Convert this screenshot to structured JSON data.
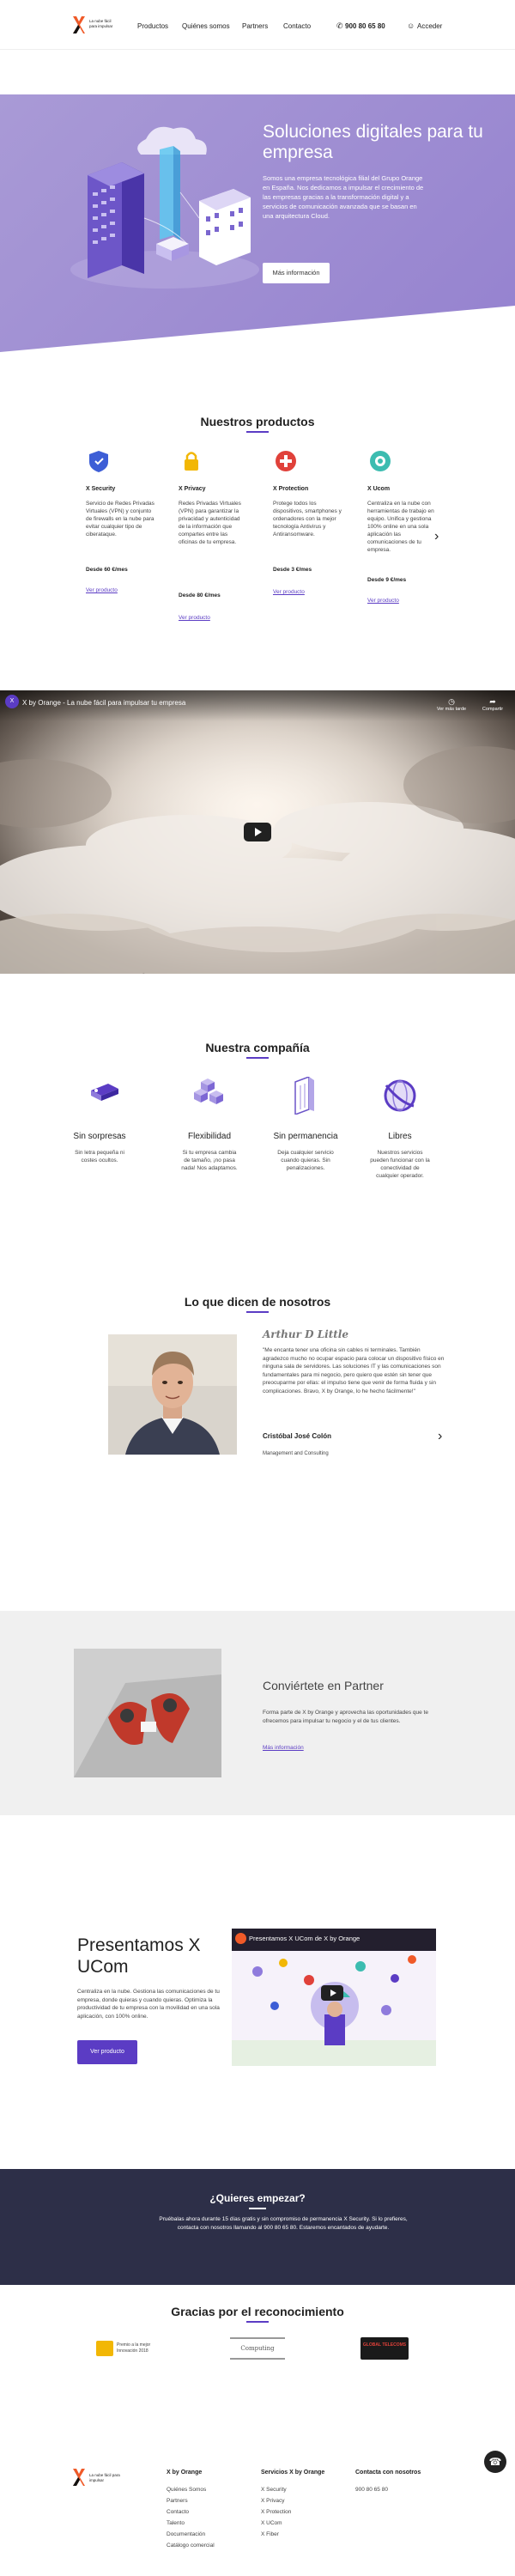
{
  "colors": {
    "accent": "#5b3cc4",
    "hero_bg": "#9d8cd2",
    "orange": "#f05a28",
    "dark_band": "#2d2f48"
  },
  "header": {
    "logo_text": "La nube fácil",
    "logo_subtext": "para impulsar",
    "nav": [
      "Productos",
      "Quiénes somos",
      "Partners",
      "Contacto"
    ],
    "phone": "900 80 65 80",
    "account": "Acceder"
  },
  "hero": {
    "title": "Soluciones digitales para tu empresa",
    "text": "Somos una empresa tecnológica filial del Grupo Orange en España. Nos dedicamos a impulsar el crecimiento de las empresas gracias a la transformación digital y a servicios de comunicación avanzada que se basan en una arquitectura Cloud.",
    "button": "Más información"
  },
  "products": {
    "title": "Nuestros productos",
    "items": [
      {
        "name": "X Security",
        "desc": "Servicio de Redes Privadas Virtuales (VPN) y conjunto de firewalls en la nube para evitar cualquier tipo de ciberataque.",
        "price": "Desde 60 €/mes",
        "link": "Ver producto",
        "icon": "shield-icon",
        "color": "#3d5ed6"
      },
      {
        "name": "X Privacy",
        "desc": "Redes Privadas Virtuales (VPN) para garantizar la privacidad y autenticidad de la información que compartes entre las oficinas de tu empresa.",
        "price": "Desde 80 €/mes",
        "link": "Ver producto",
        "icon": "lock-icon",
        "color": "#f2b705"
      },
      {
        "name": "X Protection",
        "desc": "Protege todos los dispositivos, smartphones y ordenadores con la mejor tecnología Antivirus y Antiransomware.",
        "price": "Desde 3 €/mes",
        "link": "Ver producto",
        "icon": "protection-icon",
        "color": "#e0413a"
      },
      {
        "name": "X Ucom",
        "desc": "Centraliza en la nube con herramientas de trabajo en equipo. Unifica y gestiona 100% online en una sola aplicación las comunicaciones de tu empresa.",
        "price": "Desde 9 €/mes",
        "link": "Ver producto",
        "icon": "ucom-icon",
        "color": "#3cbcb0"
      }
    ]
  },
  "video": {
    "channel": "X",
    "title": "X by Orange - La nube fácil para impulsar tu empresa",
    "watch_later": "Ver más tarde",
    "share": "Compartir"
  },
  "company": {
    "title": "Nuestra compañía",
    "features": [
      {
        "title": "Sin sorpresas",
        "desc": "Sin letra pequeña ni costes ocultos."
      },
      {
        "title": "Flexibilidad",
        "desc": "Si tu empresa cambia de tamaño, ¡no pasa nada! Nos adaptamos."
      },
      {
        "title": "Sin permanencia",
        "desc": "Deja cualquier servicio cuando quieras. Sin penalizaciones."
      },
      {
        "title": "Libres",
        "desc": "Nuestros servicios pueden funcionar con la conectividad de cualquier operador."
      }
    ]
  },
  "testimonials": {
    "title": "Lo que dicen de nosotros",
    "company_logo": "Arthur D Little",
    "quote": "\"Me encanta tener una oficina sin cables ni terminales. También agradezco mucho no ocupar espacio para colocar un dispositivo físico en ninguna sala de servidores. Las soluciones IT y las comunicaciones son fundamentales para mi negocio, pero quiero que estén sin tener que preocuparme por ellas: el impulso tiene que venir de forma fluida y sin complicaciones. Bravo, X by Orange, lo he hecho fácilmente!\"",
    "name": "Cristóbal José Colón",
    "role": "Management and Consulting"
  },
  "partner": {
    "title": "Conviértete en Partner",
    "text": "Forma parte de X by Orange y aprovecha las oportunidades que te ofrecemos para impulsar tu negocio y el de tus clientes.",
    "link": "Más información"
  },
  "ucom": {
    "title": "Presentamos X UCom",
    "text": "Centraliza en la nube. Gestiona las comunicaciones de tu empresa, donde quieras y cuando quieras. Optimiza la productividad de tu empresa con la movilidad en una sola aplicación, con 100% online.",
    "button": "Ver producto",
    "video_title": "Presentamos X UCom de X by Orange"
  },
  "cta": {
    "title": "¿Quieres empezar?",
    "text": "Pruébalas ahora durante 15 días gratis y sin compromiso de permanencia X Security. Si lo prefieres, contacta con nosotros llamando al 900 80 65 80. Estaremos encantados de ayudarte."
  },
  "awards": {
    "title": "Gracias por el reconocimiento",
    "items": [
      "Premio a la mejor Innovación 2018",
      "Computing",
      "GLOBAL TELECOMS"
    ]
  },
  "footer": {
    "logo_text": "La nube fácil para impulsar",
    "cols": [
      {
        "title": "X by Orange",
        "items": [
          "Quiénes Somos",
          "Partners",
          "Contacto",
          "Talento",
          "Documentación",
          "Catálogo comercial"
        ]
      },
      {
        "title": "Servicios X by Orange",
        "items": [
          "X Security",
          "X Privacy",
          "X Protection",
          "X UCom",
          "X Fiber"
        ]
      },
      {
        "title": "Contacta con nosotros",
        "items": [
          "900 80 65 80"
        ]
      }
    ]
  }
}
